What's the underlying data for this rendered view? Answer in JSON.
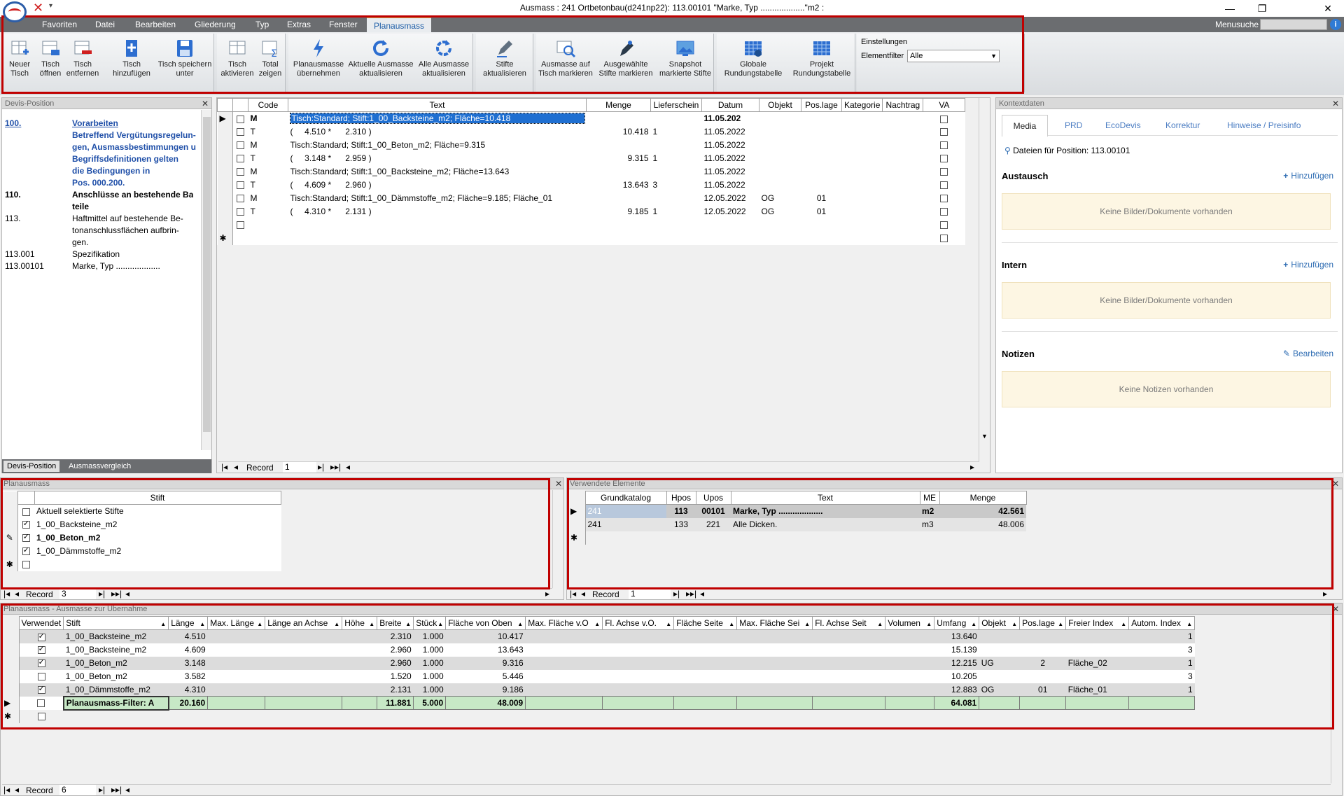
{
  "window": {
    "title": "Ausmass : 241 Ortbetonbau(d241np22): 113.00101 \"Marke, Typ ...................\"m2 :",
    "minimize": "—",
    "restore": "❐",
    "close": "✕"
  },
  "menu": {
    "items": [
      "Favoriten",
      "Datei",
      "Bearbeiten",
      "Gliederung",
      "Typ",
      "Extras",
      "Fenster",
      "Planausmass"
    ],
    "active": "Planausmass",
    "search_label": "Menusuche",
    "help_label": "i"
  },
  "ribbon": {
    "groups": [
      {
        "buttons": [
          {
            "label1": "Neuer",
            "label2": "Tisch",
            "icon": "new-table-icon"
          },
          {
            "label1": "Tisch",
            "label2": "öffnen",
            "icon": "open-table-icon"
          },
          {
            "label1": "Tisch",
            "label2": "entfernen",
            "icon": "remove-table-icon"
          },
          {
            "label1": "Tisch",
            "label2": "hinzufügen",
            "icon": "add-table-icon"
          },
          {
            "label1": "Tisch speichern",
            "label2": "unter",
            "icon": "save-icon"
          }
        ]
      },
      {
        "buttons": [
          {
            "label1": "Tisch",
            "label2": "aktivieren",
            "icon": "activate-table-icon"
          },
          {
            "label1": "Total",
            "label2": "zeigen",
            "icon": "total-icon"
          }
        ]
      },
      {
        "buttons": [
          {
            "label1": "Planausmasse",
            "label2": "übernehmen",
            "icon": "lightning-icon"
          },
          {
            "label1": "Aktuelle Ausmasse",
            "label2": "aktualisieren",
            "icon": "refresh-icon"
          },
          {
            "label1": "Alle Ausmasse",
            "label2": "aktualisieren",
            "icon": "refresh-all-icon"
          }
        ]
      },
      {
        "buttons": [
          {
            "label1": "Stifte",
            "label2": "aktualisieren",
            "icon": "pen-icon"
          }
        ]
      },
      {
        "buttons": [
          {
            "label1": "Ausmasse auf",
            "label2": "Tisch markieren",
            "icon": "mark-table-icon"
          },
          {
            "label1": "Ausgewählte",
            "label2": "Stifte markieren",
            "icon": "mark-pens-icon"
          },
          {
            "label1": "Snapshot",
            "label2": "markierte Stifte",
            "icon": "snapshot-icon"
          }
        ]
      },
      {
        "buttons": [
          {
            "label1": "Globale",
            "label2": "Rundungstabelle",
            "icon": "global-table-icon"
          },
          {
            "label1": "Projekt",
            "label2": "Rundungstabelle",
            "icon": "project-table-icon"
          }
        ]
      }
    ],
    "settings": {
      "title": "Einstellungen",
      "filter_label": "Elementfilter",
      "filter_value": "Alle"
    }
  },
  "devis": {
    "title": "Devis-Position",
    "items": [
      {
        "num": "100.",
        "text": "Vorarbeiten",
        "style": "link-bold"
      },
      {
        "num": "",
        "text": "Betreffend Vergütungsregelun-",
        "style": "link-bold"
      },
      {
        "num": "",
        "text": "gen, Ausmassbestimmungen u",
        "style": "link-bold"
      },
      {
        "num": "",
        "text": "Begriffsdefinitionen gelten",
        "style": "link-bold"
      },
      {
        "num": "",
        "text": "die Bedingungen in",
        "style": "link-bold"
      },
      {
        "num": "",
        "text": "Pos. 000.200.",
        "style": "link-bold"
      },
      {
        "num": "110.",
        "text": "Anschlüsse an bestehende Ba",
        "style": "bold"
      },
      {
        "num": "",
        "text": "teile",
        "style": "bold"
      },
      {
        "num": "113.",
        "text": "Haftmittel auf bestehende Be-",
        "style": "normal"
      },
      {
        "num": "",
        "text": "tonanschlussflächen aufbrin-",
        "style": "normal"
      },
      {
        "num": "",
        "text": "gen.",
        "style": "normal"
      },
      {
        "num": "113.001",
        "text": "Spezifikation",
        "style": "normal"
      },
      {
        "num": "113.00101",
        "text": "Marke, Typ ...................",
        "style": "normal"
      }
    ],
    "tabs": [
      "Devis-Position",
      "Ausmassvergleich"
    ]
  },
  "main_grid": {
    "columns": [
      "Code",
      "Text",
      "Menge",
      "Lieferschein",
      "Datum",
      "Objekt",
      "Pos.lage",
      "Kategorie",
      "Nachtrag",
      "VA"
    ],
    "rows": [
      {
        "code": "M",
        "text": "Tisch:Standard; Stift:1_00_Backsteine_m2; Fläche=10.418",
        "menge": "",
        "lief": "",
        "datum": "11.05.202",
        "objekt": "",
        "poslage": "",
        "selected": true,
        "bold": true
      },
      {
        "code": "T",
        "text": "(     4.510 *      2.310 )",
        "menge": "10.418",
        "lief": "1",
        "datum": "11.05.2022",
        "objekt": "",
        "poslage": ""
      },
      {
        "code": "M",
        "text": "Tisch:Standard; Stift:1_00_Beton_m2; Fläche=9.315",
        "menge": "",
        "lief": "",
        "datum": "11.05.2022",
        "objekt": "",
        "poslage": ""
      },
      {
        "code": "T",
        "text": "(     3.148 *      2.959 )",
        "menge": "9.315",
        "lief": "1",
        "datum": "11.05.2022",
        "objekt": "",
        "poslage": ""
      },
      {
        "code": "M",
        "text": "Tisch:Standard; Stift:1_00_Backsteine_m2; Fläche=13.643",
        "menge": "",
        "lief": "",
        "datum": "11.05.2022",
        "objekt": "",
        "poslage": ""
      },
      {
        "code": "T",
        "text": "(     4.609 *      2.960 )",
        "menge": "13.643",
        "lief": "3",
        "datum": "11.05.2022",
        "objekt": "",
        "poslage": ""
      },
      {
        "code": "M",
        "text": "Tisch:Standard; Stift:1_00_Dämmstoffe_m2; Fläche=9.185; Fläche_01",
        "menge": "",
        "lief": "",
        "datum": "12.05.2022",
        "objekt": "OG",
        "poslage": "01"
      },
      {
        "code": "T",
        "text": "(     4.310 *      2.131 )",
        "menge": "9.185",
        "lief": "1",
        "datum": "12.05.2022",
        "objekt": "OG",
        "poslage": "01"
      },
      {
        "code": "",
        "text": "",
        "menge": "",
        "lief": "",
        "datum": "",
        "objekt": "",
        "poslage": ""
      }
    ],
    "record_label": "Record",
    "record_value": "1"
  },
  "kontext": {
    "title": "Kontextdaten",
    "tabs": [
      "Media",
      "PRD",
      "EcoDevis",
      "Korrektur",
      "Hinweise / Preisinfo"
    ],
    "files_label": "Dateien für Position: 113.00101",
    "sections": [
      {
        "title": "Austausch",
        "action": "Hinzufügen",
        "message": "Keine Bilder/Dokumente vorhanden"
      },
      {
        "title": "Intern",
        "action": "Hinzufügen",
        "message": "Keine Bilder/Dokumente vorhanden"
      },
      {
        "title": "Notizen",
        "action": "Bearbeiten",
        "message": "Keine Notizen vorhanden"
      }
    ]
  },
  "planausmass": {
    "title": "Planausmass",
    "column": "Stift",
    "rows": [
      {
        "label": "Aktuell selektierte Stifte",
        "checked": false,
        "bold": false,
        "marker": ""
      },
      {
        "label": "1_00_Backsteine_m2",
        "checked": true,
        "bold": false,
        "marker": ""
      },
      {
        "label": "1_00_Beton_m2",
        "checked": true,
        "bold": true,
        "marker": "✎"
      },
      {
        "label": "1_00_Dämmstoffe_m2",
        "checked": true,
        "bold": false,
        "marker": ""
      },
      {
        "label": "",
        "checked": false,
        "bold": false,
        "marker": "✱"
      }
    ],
    "record_label": "Record",
    "record_value": "3"
  },
  "elemente": {
    "title": "Verwendete Elemente",
    "columns": [
      "Grundkatalog",
      "Hpos",
      "Upos",
      "Text",
      "ME",
      "Menge"
    ],
    "rows": [
      {
        "kat": "241",
        "hpos": "113",
        "upos": "00101",
        "text": "Marke, Typ ...................",
        "me": "m2",
        "menge": "42.561",
        "bold": true
      },
      {
        "kat": "241",
        "hpos": "133",
        "upos": "221",
        "text": "Alle Dicken.",
        "me": "m3",
        "menge": "48.006",
        "bold": false
      }
    ],
    "record_label": "Record",
    "record_value": "1"
  },
  "uebernahme": {
    "title": "Planausmass - Ausmasse zur Übernahme",
    "columns": [
      "Verwendet",
      "Stift",
      "Länge",
      "Max. Länge",
      "Länge an Achse",
      "Höhe",
      "Breite",
      "Stück",
      "Fläche von Oben",
      "Max. Fläche v.O",
      "Fl.  Achse v.O.",
      "Fläche Seite",
      "Max. Fläche Sei",
      "Fl.  Achse Seit",
      "Volumen",
      "Umfang",
      "Objekt",
      "Pos.lage",
      "Freier Index",
      "Autom. Index"
    ],
    "rows": [
      {
        "checked": true,
        "stift": "1_00_Backsteine_m2",
        "laenge": "4.510",
        "breite": "2.310",
        "stueck": "1.000",
        "flaeche": "10.417",
        "umfang": "13.640",
        "objekt": "",
        "poslage": "",
        "freier": "",
        "autom": "1"
      },
      {
        "checked": true,
        "stift": "1_00_Backsteine_m2",
        "laenge": "4.609",
        "breite": "2.960",
        "stueck": "1.000",
        "flaeche": "13.643",
        "umfang": "15.139",
        "objekt": "",
        "poslage": "",
        "freier": "",
        "autom": "3"
      },
      {
        "checked": true,
        "stift": "1_00_Beton_m2",
        "laenge": "3.148",
        "breite": "2.960",
        "stueck": "1.000",
        "flaeche": "9.316",
        "umfang": "12.215",
        "objekt": "UG",
        "poslage": "2",
        "freier": "Fläche_02",
        "autom": "1"
      },
      {
        "checked": false,
        "stift": "1_00_Beton_m2",
        "laenge": "3.582",
        "breite": "1.520",
        "stueck": "1.000",
        "flaeche": "5.446",
        "umfang": "10.205",
        "objekt": "",
        "poslage": "",
        "freier": "",
        "autom": "3"
      },
      {
        "checked": true,
        "stift": "1_00_Dämmstoffe_m2",
        "laenge": "4.310",
        "breite": "2.131",
        "stueck": "1.000",
        "flaeche": "9.186",
        "umfang": "12.883",
        "objekt": "OG",
        "poslage": "01",
        "freier": "Fläche_01",
        "autom": "1"
      }
    ],
    "total": {
      "stift": "Planausmass-Filter: A",
      "laenge": "20.160",
      "breite": "11.881",
      "stueck": "5.000",
      "flaeche": "48.009",
      "umfang": "64.081"
    },
    "record_label": "Record",
    "record_value": "6"
  },
  "colors": {
    "highlight_red": "#c00000",
    "selection_blue": "#1f6fd1",
    "total_green": "#c7e8c6"
  }
}
